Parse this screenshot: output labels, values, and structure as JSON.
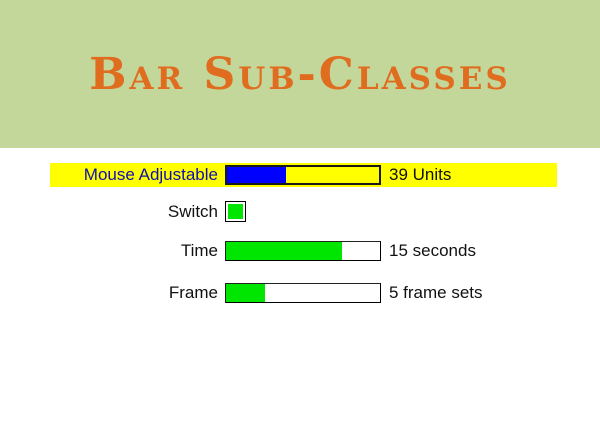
{
  "title": "Bar Sub-Classes",
  "colors": {
    "header_bg": "#c4d79b",
    "title_color": "#e06c1f",
    "highlight": "#ffff00",
    "adjustable_fill": "#0000ff",
    "green_fill": "#00e600"
  },
  "bars": {
    "mouse_adjustable": {
      "label": "Mouse Adjustable",
      "value_text": "39 Units",
      "fill_fraction": 0.39
    },
    "switch": {
      "label": "Switch",
      "on": true
    },
    "time": {
      "label": "Time",
      "value_text": "15 seconds",
      "fill_fraction": 0.75
    },
    "frame": {
      "label": "Frame",
      "value_text": "5 frame sets",
      "fill_fraction": 0.25
    }
  }
}
